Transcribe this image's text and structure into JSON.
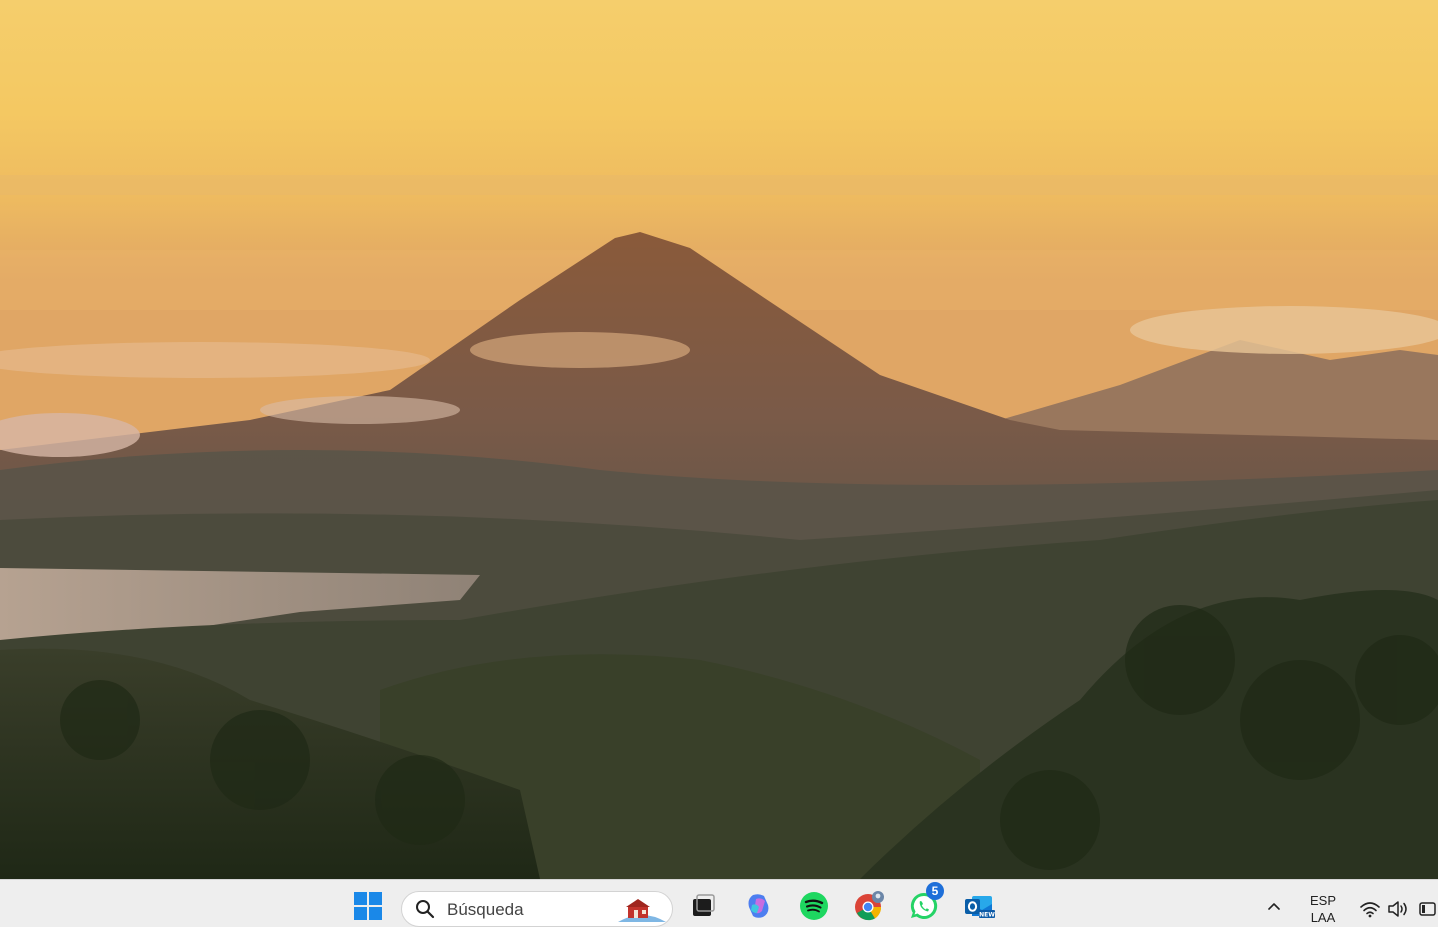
{
  "taskbar": {
    "search": {
      "placeholder": "Búsqueda"
    },
    "pinned_apps": [
      {
        "name": "start",
        "icon": "windows-logo-icon"
      },
      {
        "name": "task-view",
        "icon": "task-view-icon"
      },
      {
        "name": "copilot",
        "icon": "copilot-icon"
      },
      {
        "name": "spotify",
        "icon": "spotify-icon"
      },
      {
        "name": "chrome",
        "icon": "chrome-icon"
      },
      {
        "name": "whatsapp",
        "icon": "whatsapp-icon",
        "badge": "5"
      },
      {
        "name": "outlook",
        "icon": "outlook-new-icon",
        "badge_text": "NEW"
      }
    ],
    "tray": {
      "language_line1": "ESP",
      "language_line2": "LAA",
      "icons": [
        "chevron-up-icon",
        "wifi-icon",
        "volume-icon",
        "battery-icon"
      ]
    },
    "colors": {
      "background": "#eeeeee",
      "accent": "#1e6fd9",
      "spotify": "#1ed760",
      "whatsapp": "#25d366"
    }
  }
}
